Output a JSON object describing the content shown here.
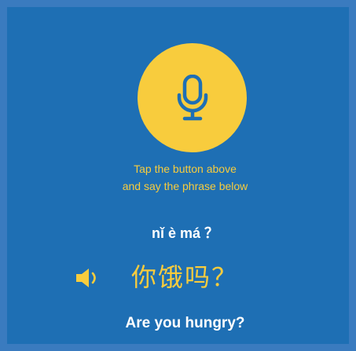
{
  "prompt": {
    "line1": "Tap the button above",
    "line2": "and say the phrase below"
  },
  "phrase": {
    "pinyin": "nǐ è má ？",
    "hanzi": "你饿吗？",
    "translation": "Are you hungry?"
  },
  "icons": {
    "record": "microphone-icon",
    "audio": "speaker-icon"
  },
  "colors": {
    "background": "#1e6fb4",
    "border": "#3a7bbf",
    "accent": "#f8cc3d",
    "text": "#ffffff"
  }
}
